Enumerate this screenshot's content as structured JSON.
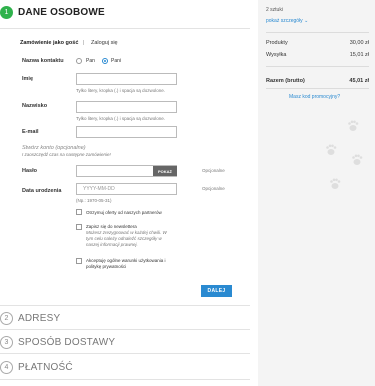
{
  "steps": [
    {
      "number": "1",
      "title": "DANE OSOBOWE"
    },
    {
      "number": "2",
      "title": "ADRESY"
    },
    {
      "number": "3",
      "title": "SPOSÓB DOSTAWY"
    },
    {
      "number": "4",
      "title": "PŁATNOŚĆ"
    }
  ],
  "tabs": {
    "guest": "Zamówienie jako gość",
    "separator": "|",
    "login": "Zaloguj się"
  },
  "form": {
    "contact_label": "Nazwa kontaktu",
    "contact_options": [
      "Pan",
      "Pani"
    ],
    "first_name_label": "Imię",
    "last_name_label": "Nazwisko",
    "email_label": "E-mail",
    "name_hint": "Tylko litery, kropka (.) i spacja są dozwolone.",
    "create_account_title": "Stwórz konto (opcjonalne)",
    "create_account_subtitle": "I zaoszczędź czas na następne zamówienie!",
    "password_label": "Hasło",
    "show_button": "POKAŻ",
    "optional": "Opcjonalne",
    "birthdate_label": "Data urodzenia",
    "birthdate_placeholder": "YYYY-MM-DD",
    "birthdate_hint": "(Np.: 1970-05-31)",
    "checkbox_offers": "Otrzymuj oferty od naszych partnerów",
    "checkbox_newsletter_1": "Zapisz się do newslettera",
    "checkbox_newsletter_2": "Możesz zrezygnować w każdej chwili. W",
    "checkbox_newsletter_3": "tym celu należy odnaleźć szczegóły w",
    "checkbox_newsletter_4": "naszej informacji prawnej.",
    "checkbox_terms_1": "Akceptuję ogólne warunki użytkowania i",
    "checkbox_terms_2": "politykę prywatności",
    "next_button": "DALEJ"
  },
  "summary": {
    "items_count": "2 sztuki",
    "show_details": "pokaż szczegóły",
    "products_label": "Produkty",
    "products_value": "30,00 zł",
    "shipping_label": "Wysyłka",
    "shipping_value": "15,01 zł",
    "total_label": "Razem (brutto)",
    "total_value": "45,01 zł",
    "promo_link": "Masz kod promocyjny?"
  },
  "colors": {
    "accent": "#2a8ad1",
    "step_active": "#2fb24c"
  }
}
